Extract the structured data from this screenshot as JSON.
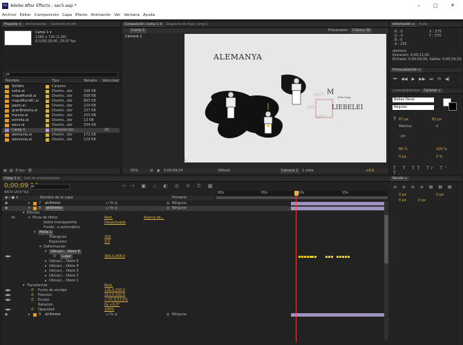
{
  "window": {
    "title": "Adobe After Effects - secS.aep *",
    "controls": [
      "–",
      "▢",
      "✕"
    ]
  },
  "menu": [
    "Archivo",
    "Editar",
    "Composición",
    "Capa",
    "Efecto",
    "Animación",
    "Ver",
    "Ventana",
    "Ayuda"
  ],
  "project": {
    "tabs": [
      "Proyecto ×",
      "Herramientas",
      "Controles de efe"
    ],
    "comp_name": "Camp 1 ▾",
    "comp_info": "1280 x 720 (1,00)",
    "comp_time": "Δ 0;00;20;00, 29,97 fps",
    "search_placeholder": "ρ▾",
    "columns": [
      "Nombre",
      "Tipo",
      "Tamaño",
      "Velocidad"
    ],
    "items": [
      {
        "name": "Sólidos",
        "type": "Carpeta",
        "size": "",
        "color": "#d8b24b",
        "icon": "folder-icon"
      },
      {
        "name": "salsa.ai",
        "type": "Diseño...dor",
        "size": "186 KB",
        "color": "#d8b24b",
        "icon": "file-icon"
      },
      {
        "name": "mapaMundi.ai",
        "type": "Diseño...dor",
        "size": "838 KB",
        "color": "#d8b24b",
        "icon": "file-icon"
      },
      {
        "name": "mapaMundiC.ai",
        "type": "Diseño...dor",
        "size": "895 KB",
        "color": "#d8b24b",
        "icon": "file-icon"
      },
      {
        "name": "japon.ai",
        "type": "Diseño...dor",
        "size": "224 KB",
        "color": "#d8b24b",
        "icon": "file-icon"
      },
      {
        "name": "granBretaña.ai",
        "type": "Diseño...dor",
        "size": "237 KB",
        "color": "#d8b24b",
        "icon": "file-icon"
      },
      {
        "name": "francia.ai",
        "type": "Diseño...dor",
        "size": "255 KB",
        "color": "#d8b24b",
        "icon": "file-icon"
      },
      {
        "name": "estrella.ai",
        "type": "Diseño...dor",
        "size": "13 KB",
        "color": "#d8b24b",
        "icon": "file-icon"
      },
      {
        "name": "eeuu.ai",
        "type": "Diseño...dor",
        "size": "334 KB",
        "color": "#d8b24b",
        "icon": "file-icon"
      },
      {
        "name": "Camp 1",
        "type": "Composición",
        "size": "",
        "speed": "29",
        "color": "#b8a0d8",
        "icon": "comp-icon",
        "selected": true
      },
      {
        "name": "alemania.ai",
        "type": "Diseño...dor",
        "size": "172 KB",
        "color": "#d8b24b",
        "icon": "file-icon"
      },
      {
        "name": "alemania.ai",
        "type": "Diseño...dor",
        "size": "129 KB",
        "color": "#d8b24b",
        "icon": "file-icon"
      }
    ],
    "footer": "8 bpc"
  },
  "viewer": {
    "tabs": [
      "Composición: Camp 1 ≡",
      "Diagrama de flujo: Camp 1"
    ],
    "sub_tab": "Camp 1",
    "renderer": "Procesador:",
    "renderer_value": "Clásico 3D",
    "label": "Cámara 1",
    "art": {
      "title": "ALEMANYA",
      "year1": "1907",
      "year2": "1907",
      "year3": "1907",
      "letter": "M",
      "signature": "Fritz Lang",
      "word": "LIEBELEI"
    },
    "footer": {
      "zoom": "50%",
      "time": "0;00;09;14",
      "quality": "(Mitad)",
      "camera": "Cámara 1",
      "views": "1 vista",
      "offset": "+0,0"
    }
  },
  "info": {
    "tabs": [
      "Información ×",
      "Audio"
    ],
    "r": "R : 0",
    "g": "G : 0",
    "b": "B : 0",
    "a": "A : 255",
    "x": "X : 375",
    "yv": "Y : 570",
    "clip_name": "alemani",
    "duration": "Duración: 0;00;11;00",
    "in_out": "Entrada: 0;00;09;00, Salida: 0;00;19;29"
  },
  "preview": {
    "tab": "Previsualización ×",
    "buttons": [
      "⏮",
      "◀◀",
      "▶",
      "▶▶",
      "⏭",
      "⟲",
      "◀|"
    ]
  },
  "effects": {
    "tabs": [
      "s preestablecidos",
      "Carácter ×"
    ],
    "font": "Bebas Neue",
    "style": "Regular",
    "size": "67 px",
    "leading": "82 px",
    "tracking": "Métrica",
    "kerning": "0",
    "stroke": "- px",
    "vscale": "66 %",
    "hscale": "100 %",
    "baseline": "0 px",
    "tsume": "0 %"
  },
  "paragraph": {
    "tab": "Párrafo ×",
    "indent1": "0 px",
    "indent2": "0 px",
    "indent3": "0 px",
    "space1": "0 px",
    "space2": "0 px"
  },
  "timeline": {
    "tabs": [
      "Camp 1 ×",
      "Cola de procesamiento"
    ],
    "time": "0;00;09;14",
    "fps": "00074 (29.97 fps)",
    "search_placeholder": "ρ▾",
    "col_name": "Nombre de la capa",
    "col_parent": "Primario",
    "ruler": [
      "00s",
      "05s",
      "10s",
      "15s"
    ],
    "layers": [
      {
        "num": "7",
        "name": "alr3mmo",
        "parent": "Ninguno",
        "expanded": false,
        "selected": false
      },
      {
        "num": "8",
        "name": "alr3mmo",
        "parent": "Ninguno",
        "expanded": true,
        "selected": true
      }
    ],
    "props": [
      {
        "label": "Efectos",
        "value": "",
        "indent": 2,
        "tw": "▾"
      },
      {
        "label": "Pinza de títere",
        "value": "Rest.",
        "value2": "Acerca de...",
        "indent": 3,
        "tw": "▾",
        "fx": true
      },
      {
        "label": "Sobre transparente",
        "value": "Desactivado",
        "indent": 5,
        "tw": ""
      },
      {
        "label": "Fondo...o automático",
        "value": "",
        "indent": 5,
        "tw": ""
      },
      {
        "label": "Malla 1",
        "value": "",
        "indent": 4,
        "tw": "▾",
        "hl": true
      },
      {
        "label": "Triángulos",
        "value": "350",
        "indent": 6,
        "tw": ""
      },
      {
        "label": "Expansión",
        "value": "3,0",
        "indent": 6,
        "tw": ""
      },
      {
        "label": "Deformación",
        "value": "",
        "indent": 5,
        "tw": "▾"
      },
      {
        "label": "Ubicaci... títere 6",
        "value": "",
        "indent": 6,
        "tw": "▾",
        "hl": true
      },
      {
        "label": "Lugar",
        "value": "360,0,458,0",
        "indent": 8,
        "tw": "",
        "kf": true,
        "hl": true
      },
      {
        "label": "Ubicaci... títere 5",
        "value": "",
        "indent": 6,
        "tw": "▸"
      },
      {
        "label": "Ubicaci... títere 4",
        "value": "",
        "indent": 6,
        "tw": "▸"
      },
      {
        "label": "Ubicaci... títere 3",
        "value": "",
        "indent": 6,
        "tw": "▸"
      },
      {
        "label": "Ubicaci... títere 2",
        "value": "",
        "indent": 6,
        "tw": "▸"
      },
      {
        "label": "Ubicaci... títere 1",
        "value": "",
        "indent": 6,
        "tw": "▸"
      },
      {
        "label": "Transformar",
        "value": "Rest.",
        "indent": 2,
        "tw": "▾"
      },
      {
        "label": "Punto de anclaje",
        "value": "126,5,150,5",
        "indent": 4,
        "tw": "",
        "kf": true
      },
      {
        "label": "Posición",
        "value": "313,5,332,6",
        "indent": 4,
        "tw": "",
        "kf": true
      },
      {
        "label": "Escala",
        "value": "∞ 57,0,57,0%",
        "indent": 4,
        "tw": "",
        "kf": true
      },
      {
        "label": "Rotación",
        "value": "0x +0,0°",
        "indent": 4,
        "tw": ""
      },
      {
        "label": "Opacidad",
        "value": "100%",
        "indent": 4,
        "tw": "",
        "kf": true
      }
    ],
    "last_layer": {
      "num": "9",
      "name": "alr3mmo",
      "parent": "Ninguno"
    }
  },
  "right_bottom": {
    "tab": "Párrafo"
  }
}
